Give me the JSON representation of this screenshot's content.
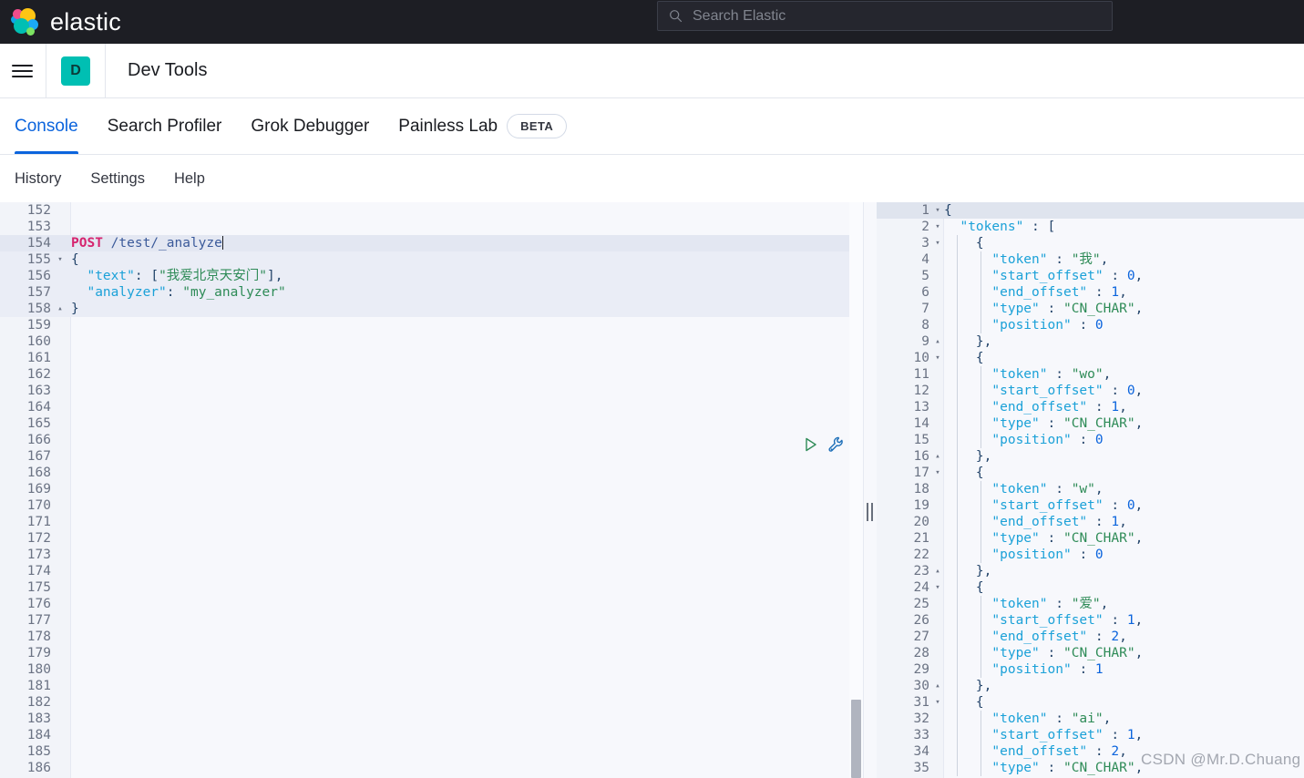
{
  "global_nav": {
    "brand": "elastic",
    "search": {
      "placeholder": "Search Elastic",
      "value": "",
      "icon": "search-icon"
    }
  },
  "app_header": {
    "menu_icon": "hamburger-menu-icon",
    "app_initial": "D",
    "app_badge_color": "#00bfb3",
    "title": "Dev Tools"
  },
  "tabs": {
    "active_color": "#0b64dd",
    "items": [
      {
        "label": "Console",
        "active": true
      },
      {
        "label": "Search Profiler",
        "active": false
      },
      {
        "label": "Grok Debugger",
        "active": false
      },
      {
        "label": "Painless Lab",
        "active": false,
        "badge": "BETA"
      }
    ]
  },
  "submenu": {
    "items": [
      {
        "label": "History"
      },
      {
        "label": "Settings"
      },
      {
        "label": "Help"
      }
    ]
  },
  "request_editor": {
    "actions": {
      "play_icon": "play-request-icon",
      "wrench_icon": "wrench-settings-icon"
    },
    "first_line_number": 152,
    "lines": [
      {
        "n": 152,
        "fold": "",
        "hl": false,
        "content": ""
      },
      {
        "n": 153,
        "fold": "",
        "hl": false,
        "content": ""
      },
      {
        "n": 154,
        "fold": "",
        "hl": true,
        "content": "POST /test/_analyze",
        "kind": "request-line",
        "method": "POST",
        "url": "/test/_analyze",
        "cursor": true
      },
      {
        "n": 155,
        "fold": "down",
        "hl": false,
        "content": "{",
        "kind": "body"
      },
      {
        "n": 156,
        "fold": "",
        "hl": false,
        "content": "  \"text\": [\"我爱北京天安门\"],",
        "kind": "body"
      },
      {
        "n": 157,
        "fold": "",
        "hl": false,
        "content": "  \"analyzer\": \"my_analyzer\"",
        "kind": "body"
      },
      {
        "n": 158,
        "fold": "up",
        "hl": false,
        "content": "}",
        "kind": "body"
      },
      {
        "n": 159,
        "fold": "",
        "hl": false,
        "content": ""
      },
      {
        "n": 160,
        "fold": "",
        "hl": false,
        "content": ""
      },
      {
        "n": 161,
        "fold": "",
        "hl": false,
        "content": ""
      },
      {
        "n": 162,
        "fold": "",
        "hl": false,
        "content": ""
      },
      {
        "n": 163,
        "fold": "",
        "hl": false,
        "content": ""
      },
      {
        "n": 164,
        "fold": "",
        "hl": false,
        "content": ""
      },
      {
        "n": 165,
        "fold": "",
        "hl": false,
        "content": ""
      },
      {
        "n": 166,
        "fold": "",
        "hl": false,
        "content": ""
      },
      {
        "n": 167,
        "fold": "",
        "hl": false,
        "content": ""
      },
      {
        "n": 168,
        "fold": "",
        "hl": false,
        "content": ""
      },
      {
        "n": 169,
        "fold": "",
        "hl": false,
        "content": ""
      },
      {
        "n": 170,
        "fold": "",
        "hl": false,
        "content": ""
      },
      {
        "n": 171,
        "fold": "",
        "hl": false,
        "content": ""
      },
      {
        "n": 172,
        "fold": "",
        "hl": false,
        "content": ""
      },
      {
        "n": 173,
        "fold": "",
        "hl": false,
        "content": ""
      },
      {
        "n": 174,
        "fold": "",
        "hl": false,
        "content": ""
      },
      {
        "n": 175,
        "fold": "",
        "hl": false,
        "content": ""
      },
      {
        "n": 176,
        "fold": "",
        "hl": false,
        "content": ""
      },
      {
        "n": 177,
        "fold": "",
        "hl": false,
        "content": ""
      },
      {
        "n": 178,
        "fold": "",
        "hl": false,
        "content": ""
      },
      {
        "n": 179,
        "fold": "",
        "hl": false,
        "content": ""
      },
      {
        "n": 180,
        "fold": "",
        "hl": false,
        "content": ""
      },
      {
        "n": 181,
        "fold": "",
        "hl": false,
        "content": ""
      },
      {
        "n": 182,
        "fold": "",
        "hl": false,
        "content": ""
      },
      {
        "n": 183,
        "fold": "",
        "hl": false,
        "content": ""
      },
      {
        "n": 184,
        "fold": "",
        "hl": false,
        "content": ""
      },
      {
        "n": 185,
        "fold": "",
        "hl": false,
        "content": ""
      },
      {
        "n": 186,
        "fold": "",
        "hl": false,
        "content": ""
      }
    ]
  },
  "response_panel": {
    "lines": [
      {
        "n": 1,
        "fold": "down",
        "hl": true,
        "indent": 0,
        "content": "{"
      },
      {
        "n": 2,
        "fold": "down",
        "hl": false,
        "indent": 0,
        "content": "  \"tokens\" : ["
      },
      {
        "n": 3,
        "fold": "down",
        "hl": false,
        "indent": 1,
        "content": "    {"
      },
      {
        "n": 4,
        "fold": "",
        "hl": false,
        "indent": 2,
        "content": "      \"token\" : \"我\","
      },
      {
        "n": 5,
        "fold": "",
        "hl": false,
        "indent": 2,
        "content": "      \"start_offset\" : 0,"
      },
      {
        "n": 6,
        "fold": "",
        "hl": false,
        "indent": 2,
        "content": "      \"end_offset\" : 1,"
      },
      {
        "n": 7,
        "fold": "",
        "hl": false,
        "indent": 2,
        "content": "      \"type\" : \"CN_CHAR\","
      },
      {
        "n": 8,
        "fold": "",
        "hl": false,
        "indent": 2,
        "content": "      \"position\" : 0"
      },
      {
        "n": 9,
        "fold": "up",
        "hl": false,
        "indent": 1,
        "content": "    },"
      },
      {
        "n": 10,
        "fold": "down",
        "hl": false,
        "indent": 1,
        "content": "    {"
      },
      {
        "n": 11,
        "fold": "",
        "hl": false,
        "indent": 2,
        "content": "      \"token\" : \"wo\","
      },
      {
        "n": 12,
        "fold": "",
        "hl": false,
        "indent": 2,
        "content": "      \"start_offset\" : 0,"
      },
      {
        "n": 13,
        "fold": "",
        "hl": false,
        "indent": 2,
        "content": "      \"end_offset\" : 1,"
      },
      {
        "n": 14,
        "fold": "",
        "hl": false,
        "indent": 2,
        "content": "      \"type\" : \"CN_CHAR\","
      },
      {
        "n": 15,
        "fold": "",
        "hl": false,
        "indent": 2,
        "content": "      \"position\" : 0"
      },
      {
        "n": 16,
        "fold": "up",
        "hl": false,
        "indent": 1,
        "content": "    },"
      },
      {
        "n": 17,
        "fold": "down",
        "hl": false,
        "indent": 1,
        "content": "    {"
      },
      {
        "n": 18,
        "fold": "",
        "hl": false,
        "indent": 2,
        "content": "      \"token\" : \"w\","
      },
      {
        "n": 19,
        "fold": "",
        "hl": false,
        "indent": 2,
        "content": "      \"start_offset\" : 0,"
      },
      {
        "n": 20,
        "fold": "",
        "hl": false,
        "indent": 2,
        "content": "      \"end_offset\" : 1,"
      },
      {
        "n": 21,
        "fold": "",
        "hl": false,
        "indent": 2,
        "content": "      \"type\" : \"CN_CHAR\","
      },
      {
        "n": 22,
        "fold": "",
        "hl": false,
        "indent": 2,
        "content": "      \"position\" : 0"
      },
      {
        "n": 23,
        "fold": "up",
        "hl": false,
        "indent": 1,
        "content": "    },"
      },
      {
        "n": 24,
        "fold": "down",
        "hl": false,
        "indent": 1,
        "content": "    {"
      },
      {
        "n": 25,
        "fold": "",
        "hl": false,
        "indent": 2,
        "content": "      \"token\" : \"爱\","
      },
      {
        "n": 26,
        "fold": "",
        "hl": false,
        "indent": 2,
        "content": "      \"start_offset\" : 1,"
      },
      {
        "n": 27,
        "fold": "",
        "hl": false,
        "indent": 2,
        "content": "      \"end_offset\" : 2,"
      },
      {
        "n": 28,
        "fold": "",
        "hl": false,
        "indent": 2,
        "content": "      \"type\" : \"CN_CHAR\","
      },
      {
        "n": 29,
        "fold": "",
        "hl": false,
        "indent": 2,
        "content": "      \"position\" : 1"
      },
      {
        "n": 30,
        "fold": "up",
        "hl": false,
        "indent": 1,
        "content": "    },"
      },
      {
        "n": 31,
        "fold": "down",
        "hl": false,
        "indent": 1,
        "content": "    {"
      },
      {
        "n": 32,
        "fold": "",
        "hl": false,
        "indent": 2,
        "content": "      \"token\" : \"ai\","
      },
      {
        "n": 33,
        "fold": "",
        "hl": false,
        "indent": 2,
        "content": "      \"start_offset\" : 1,"
      },
      {
        "n": 34,
        "fold": "",
        "hl": false,
        "indent": 2,
        "content": "      \"end_offset\" : 2,"
      },
      {
        "n": 35,
        "fold": "",
        "hl": false,
        "indent": 2,
        "content": "      \"type\" : \"CN_CHAR\","
      }
    ]
  },
  "splitter": {
    "name": "panel-resize-handle"
  },
  "watermark": "CSDN @Mr.D.Chuang"
}
